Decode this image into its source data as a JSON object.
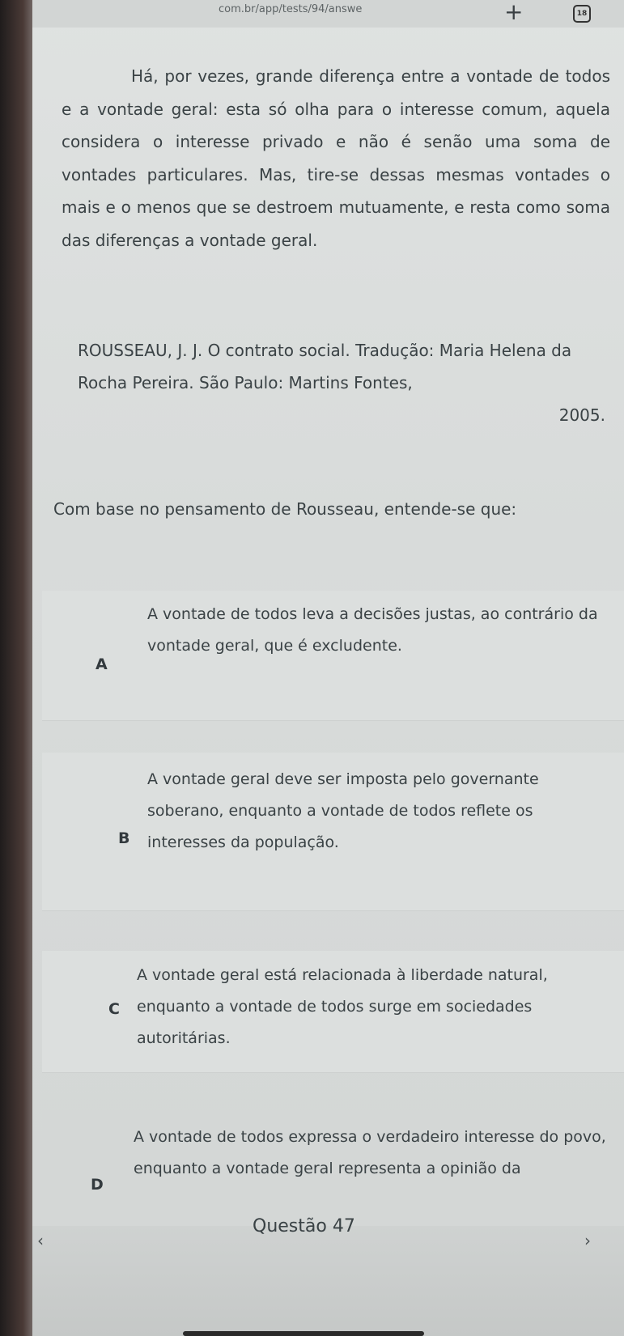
{
  "browser": {
    "url": "com.br/app/tests/94/answe",
    "new_tab": "+",
    "tab_count": "18",
    "menu": "⋮"
  },
  "passage": {
    "text": "Há, por vezes, grande diferença entre a vontade de todos e a vontade geral: esta só olha para o interesse comum, aquela considera o interesse privado e não é senão uma soma de vontades particulares. Mas, tire-se dessas mesmas vontades o mais e o menos que se destroem mutuamente, e resta como soma das diferenças a vontade geral."
  },
  "citation": {
    "text": "ROUSSEAU, J. J. O contrato social. Tradução: Maria Helena da Rocha Pereira. São Paulo: Martins Fontes,",
    "year": "2005."
  },
  "question": {
    "prompt": "Com base no pensamento de Rousseau, entende-se que:"
  },
  "options": [
    {
      "letter": "A",
      "text": "A vontade de todos leva a decisões justas, ao contrário da vontade geral, que é excludente."
    },
    {
      "letter": "B",
      "text": "A vontade geral deve ser imposta pelo governante soberano, enquanto a vontade de todos reflete os interesses da população."
    },
    {
      "letter": "C",
      "text": "A vontade geral está relacionada à liberdade natural, enquanto a vontade de todos surge em sociedades autoritárias."
    },
    {
      "letter": "D",
      "text": "A vontade de todos expressa o verdadeiro interesse do povo, enquanto a vontade geral representa a opinião da"
    }
  ],
  "footer": {
    "label": "Questão 47",
    "prev": "‹",
    "next": "›"
  }
}
